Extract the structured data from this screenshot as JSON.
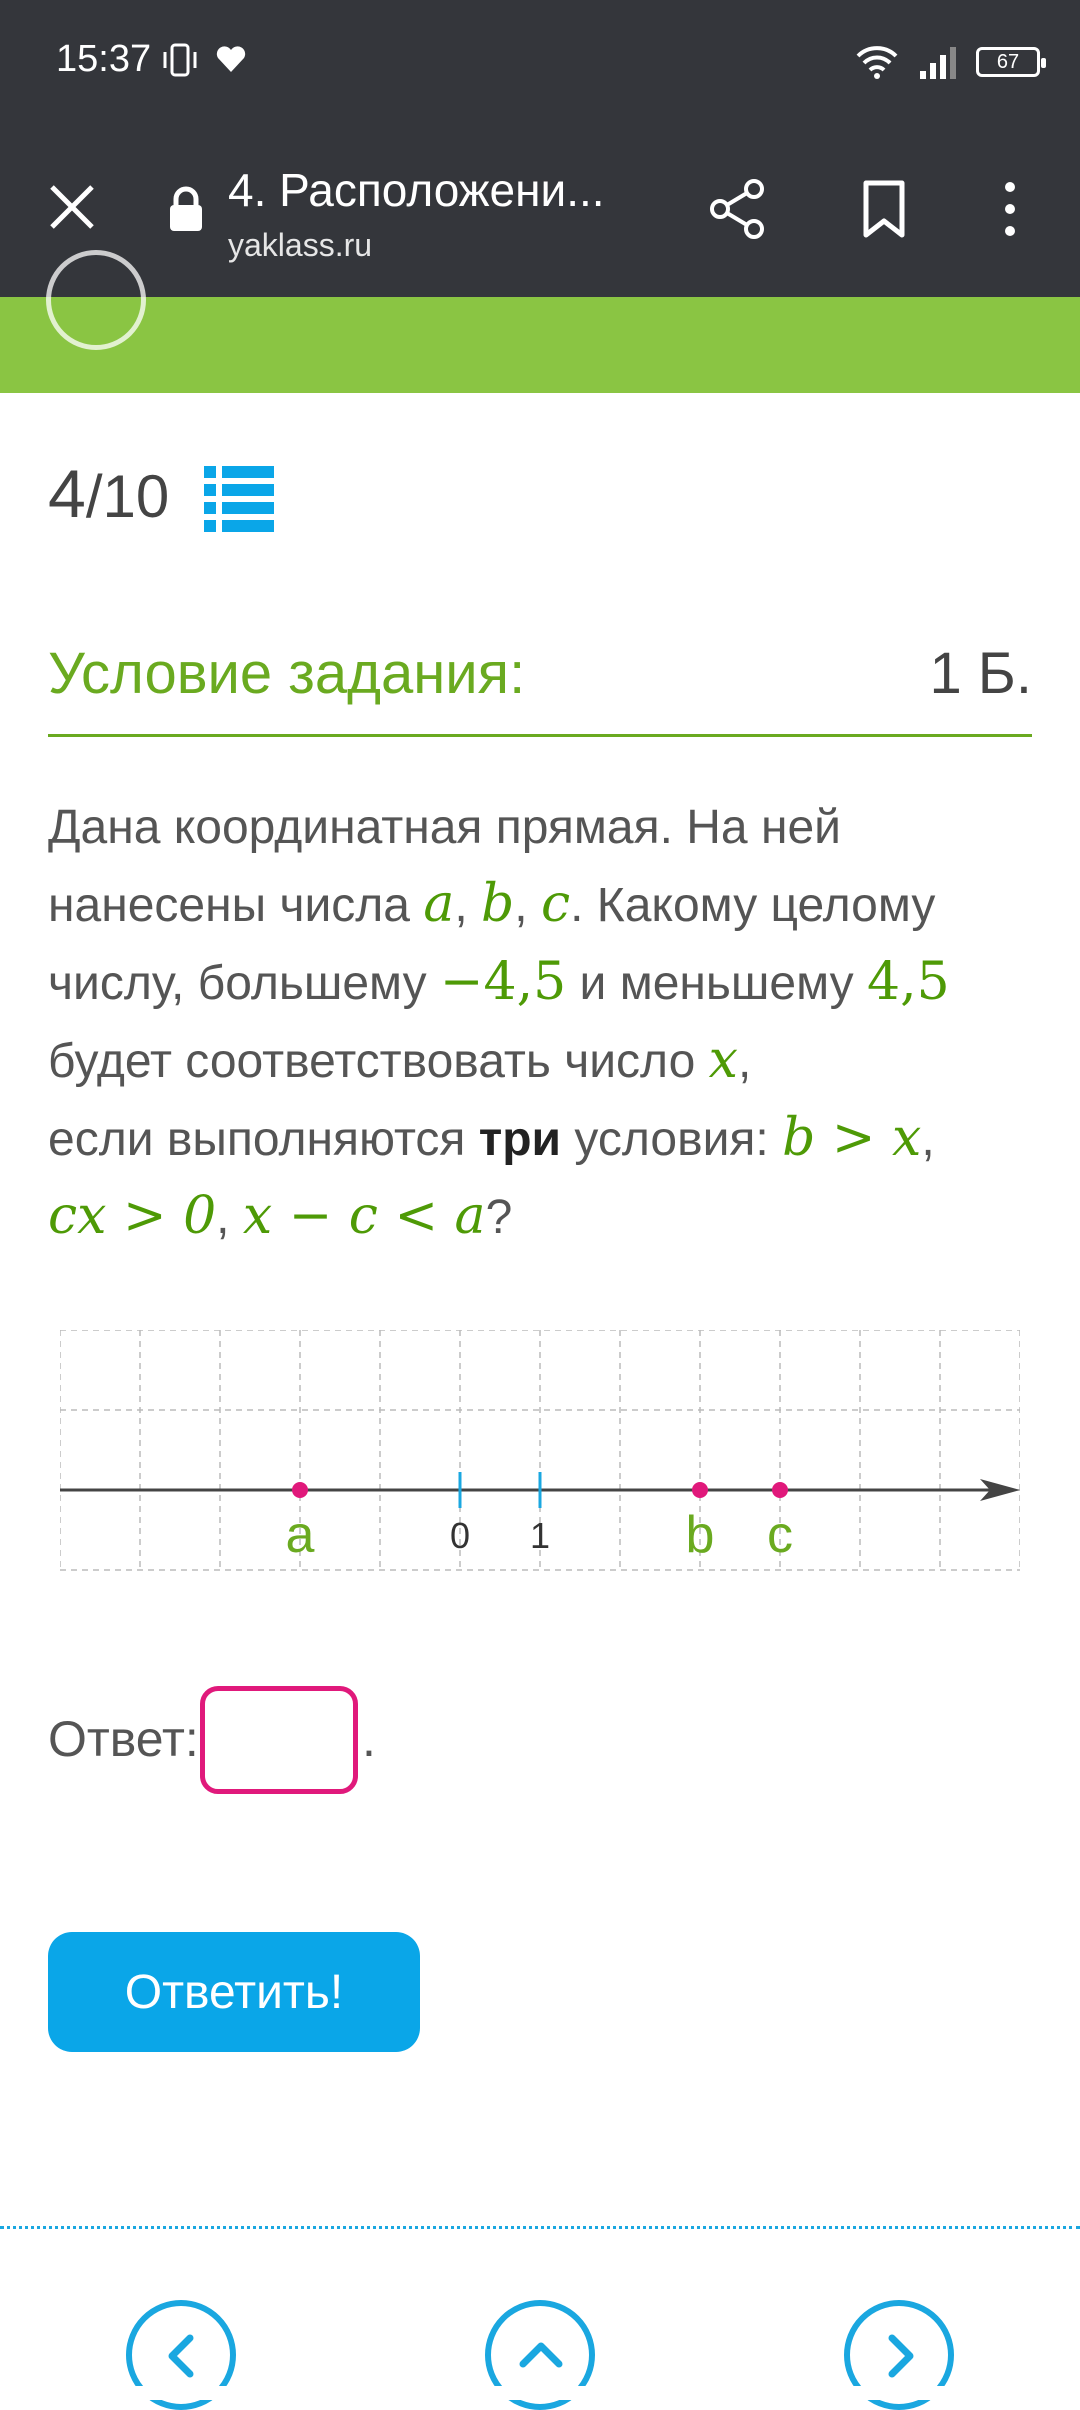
{
  "status_bar": {
    "time": "15:37",
    "battery": "67"
  },
  "browser": {
    "title": "4. Расположени...",
    "domain": "yaklass.ru"
  },
  "counter": {
    "current": "4",
    "total": "/10"
  },
  "condition": {
    "title": "Условие задания:",
    "points": "1 Б."
  },
  "problem": {
    "t1": "Дана координатная прямая. На ней нанесены числа ",
    "v_a": "a",
    "sep1": ", ",
    "v_b": "b",
    "sep2": ", ",
    "v_c": "c",
    "t2": ". Какому целому числу, большему ",
    "n1": "−4,5",
    "t3": " и меньшему ",
    "n2": "4,5",
    "t4": " будет соответствовать число ",
    "v_x": "x",
    "t5": ",",
    "t6": "если выполняются ",
    "bold": "три",
    "t7": " условия: ",
    "cond1": "b > x",
    "sep3": ",",
    "cond2": "cx > 0",
    "sep4": ", ",
    "cond3": "x − c < a",
    "t8": "?"
  },
  "chart_data": {
    "type": "number-line",
    "points": [
      {
        "label": "a",
        "value": -2
      },
      {
        "label": "b",
        "value": 3
      },
      {
        "label": "c",
        "value": 4
      }
    ],
    "ticks": [
      {
        "label": "0",
        "value": 0
      },
      {
        "label": "1",
        "value": 1
      }
    ],
    "xlim": [
      -5,
      7
    ],
    "grid": true,
    "colors": {
      "point": "#e0197b",
      "point_label": "#6aaa20",
      "tick": "#1aa7e0",
      "axis": "#444444"
    }
  },
  "answer": {
    "label": "Ответ:",
    "value": "",
    "trailing": "."
  },
  "submit": {
    "label": "Ответить!"
  }
}
